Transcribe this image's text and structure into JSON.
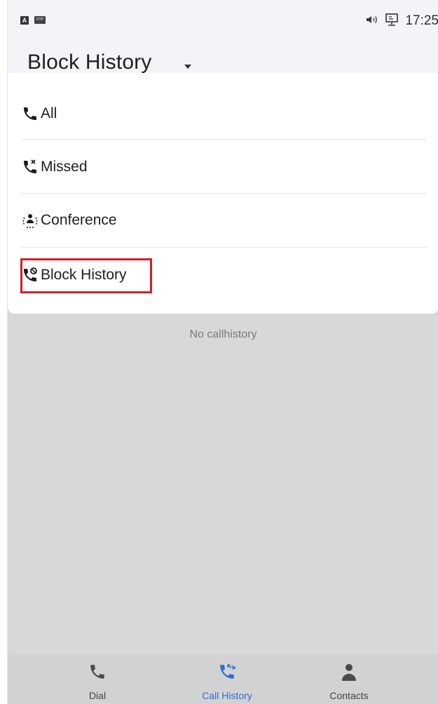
{
  "status_bar": {
    "indicator_a": "A",
    "indicator_ftp": "FTP",
    "time": "17:25"
  },
  "header": {
    "title": "Block History"
  },
  "menu": {
    "items": [
      {
        "label": "All",
        "icon": "phone-icon"
      },
      {
        "label": "Missed",
        "icon": "missed-call-icon"
      },
      {
        "label": "Conference",
        "icon": "conference-icon"
      },
      {
        "label": "Block History",
        "icon": "block-call-icon",
        "selected": true
      }
    ]
  },
  "main": {
    "empty_message": "No callhistory"
  },
  "bottom_nav": {
    "items": [
      {
        "label": "Dial",
        "icon": "phone-icon"
      },
      {
        "label": "Call History",
        "icon": "call-history-icon",
        "active": true
      },
      {
        "label": "Contacts",
        "icon": "contacts-icon"
      }
    ]
  },
  "colors": {
    "accent": "#2f6fd4",
    "highlight_border": "#d01f2a",
    "background": "#d8d8d8"
  }
}
